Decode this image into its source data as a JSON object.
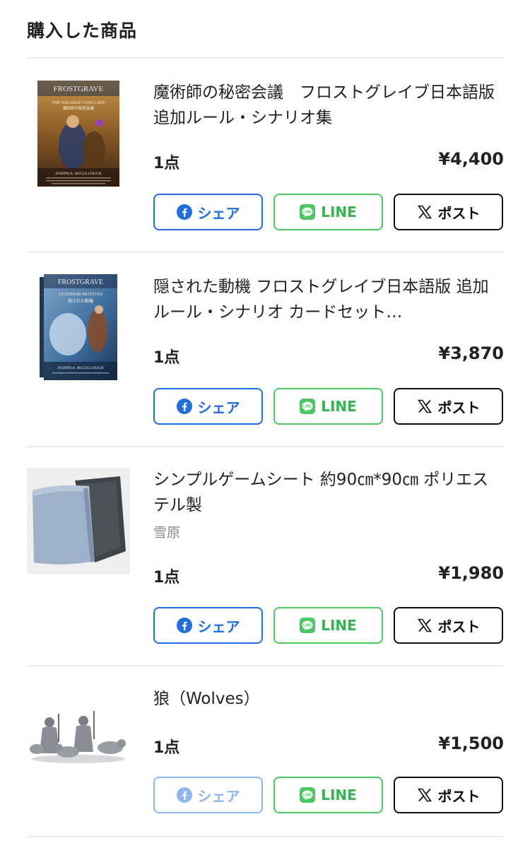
{
  "page": {
    "title": "購入した商品"
  },
  "share": {
    "facebook": "シェア",
    "line": "LINE",
    "x": "ポスト"
  },
  "colors": {
    "facebook": "#1f6fe0",
    "line": "#4cc764",
    "x": "#111111",
    "divider": "#ececec"
  },
  "items": [
    {
      "title": "魔術師の秘密会議　フロストグレイブ日本語版　追加ルール・シナリオ集",
      "sub": "",
      "qty": "1点",
      "price": "¥4,400",
      "thumb_text": {
        "brand": "FROSTGRAVE",
        "subtitle": "THE WIZARDS' CONCLAVE",
        "jp": "魔術師の秘密会議",
        "author": "JOSEPH A. McCULLOUGH"
      }
    },
    {
      "title": "隠された動機 フロストグレイブ日本語版 追加ルール・シナリオ カードセット（FROSTGRAVE: ULTERIOR MOTIVES）",
      "sub": "",
      "qty": "1点",
      "price": "¥3,870",
      "thumb_text": {
        "brand": "FROSTGRAVE",
        "subtitle": "ULTERIOR MOTIVES",
        "jp": "隠された動機",
        "author": "JOSEPH A. McCULLOUGH"
      }
    },
    {
      "title": "シンプルゲームシート 約90㎝*90㎝ ポリエステル製",
      "sub": "雪原",
      "qty": "1点",
      "price": "¥1,980"
    },
    {
      "title": "狼（Wolves）",
      "sub": "",
      "qty": "1点",
      "price": "¥1,500"
    }
  ]
}
